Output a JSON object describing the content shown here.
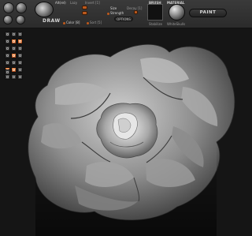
{
  "toolbar": {
    "alpha_label": "Alt(rel)",
    "lazy_label": "Lazy",
    "invert_label": "Invert [1]",
    "draw_label": "DRAW",
    "size_label": "Size",
    "decay_label": "Decay [1]",
    "strength_label": "Strength",
    "options_label": "OPTIONS",
    "color_label": "Color [8]",
    "sort_label": "Sort [5]",
    "brush_section": "BRUSH",
    "brush_name": "Stabilize",
    "material_section": "MATERIAL",
    "material_name": "WhiteSkulls",
    "paint_label": "PAINT",
    "accent_color": "#c05a1c"
  },
  "left_panel": {
    "rows": [
      {
        "icons": [
          "grid-icon",
          "grid-icon",
          "grid-icon"
        ],
        "active": [
          false,
          false,
          false
        ]
      },
      {
        "icons": [
          "grid-icon",
          "grid-icon",
          "grid-icon"
        ],
        "active": [
          true,
          true,
          false
        ]
      },
      {
        "icons": [
          "grid-icon",
          "grid-icon",
          "grid-icon"
        ],
        "active": [
          false,
          false,
          false
        ]
      },
      {
        "icons": [
          "grid-icon",
          "grid-icon",
          "grid-icon"
        ],
        "active": [
          false,
          true,
          false
        ]
      },
      {
        "icons": [
          "grid-icon",
          "grid-icon",
          "grid-icon"
        ],
        "active": [
          false,
          false,
          false
        ]
      },
      {
        "icons": [
          "grid-icon",
          "grid-icon",
          "grid-icon"
        ],
        "active": [
          true,
          true,
          false
        ]
      },
      {
        "icons": [
          "grid-icon",
          "grid-icon",
          "grid-icon"
        ],
        "active": [
          false,
          false,
          false
        ]
      },
      {
        "icons": [
          "grid-icon"
        ],
        "active": [
          false
        ]
      }
    ]
  },
  "canvas": {
    "subject": "sculpted-rose-mesh",
    "background": "#151515",
    "surface_color": "#9a9a9a"
  }
}
